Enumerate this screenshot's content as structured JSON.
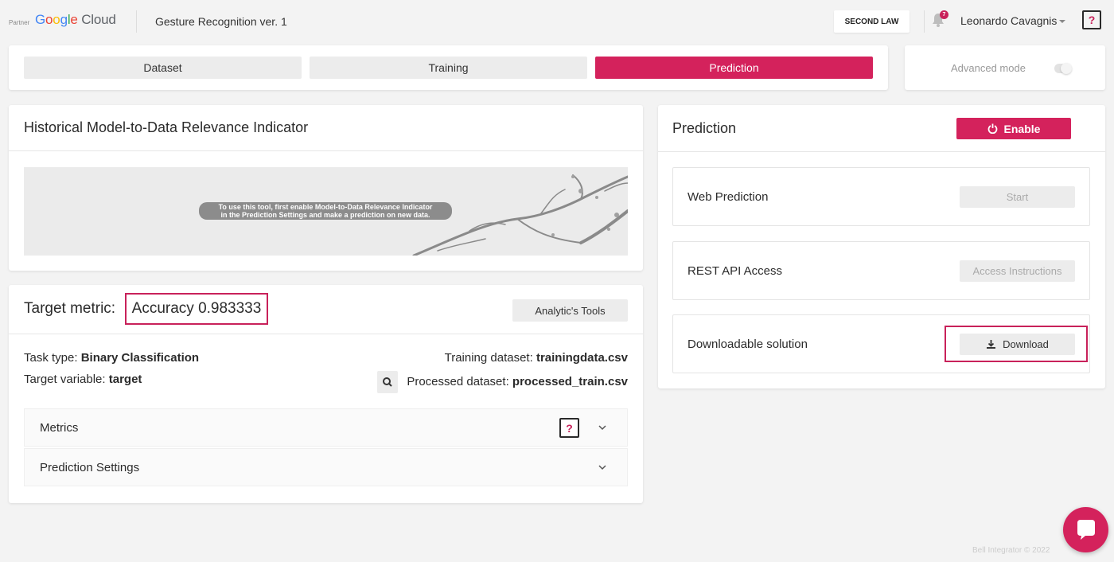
{
  "header": {
    "partner_label": "Partner",
    "logo_word1": "Google",
    "logo_word2": "Cloud",
    "project_name": "Gesture Recognition ver. 1",
    "org_button": "SECOND LAW",
    "notification_count": "7",
    "user_name": "Leonardo Cavagnis",
    "help_label": "?"
  },
  "tabs": [
    {
      "label": "Dataset",
      "active": false
    },
    {
      "label": "Training",
      "active": false
    },
    {
      "label": "Prediction",
      "active": true
    }
  ],
  "advanced_mode": {
    "label": "Advanced mode",
    "enabled": false
  },
  "historical": {
    "title": "Historical Model-to-Data Relevance Indicator",
    "message_line1": "To use this tool, first enable Model-to-Data Relevance Indicator",
    "message_line2": "in the Prediction Settings and make a prediction on new data."
  },
  "target": {
    "label": "Target metric:",
    "metric_value": "Accuracy 0.983333",
    "analytics_button": "Analytic's Tools",
    "task_type_label": "Task type:",
    "task_type_value": "Binary Classification",
    "target_variable_label": "Target variable:",
    "target_variable_value": "target",
    "training_dataset_label": "Training dataset:",
    "training_dataset_value": "trainingdata.csv",
    "processed_dataset_label": "Processed dataset:",
    "processed_dataset_value": "processed_train.csv",
    "accordion": [
      {
        "label": "Metrics"
      },
      {
        "label": "Prediction Settings"
      }
    ],
    "metrics_help": "?"
  },
  "prediction": {
    "title": "Prediction",
    "enable_button": "Enable",
    "items": [
      {
        "label": "Web Prediction",
        "button": "Start"
      },
      {
        "label": "REST API Access",
        "button": "Access Instructions"
      },
      {
        "label": "Downloadable solution",
        "button": "Download"
      }
    ]
  },
  "footer": {
    "text": "Bell Integrator © 2022"
  },
  "colors": {
    "accent": "#d4225c",
    "highlight_border": "#c8215a",
    "background": "#f3f3f3"
  }
}
